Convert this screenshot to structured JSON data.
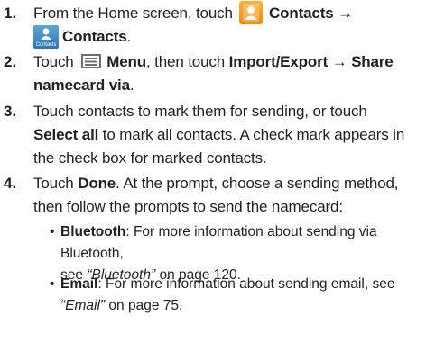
{
  "steps": [
    {
      "number": "1.",
      "text_a": "From the Home screen, touch",
      "icon_a": "contacts-app-icon",
      "bold_a": "Contacts →",
      "icon_b": "contacts-tab-icon",
      "icon_b_label": "Contacts",
      "bold_b": "Contacts",
      "text_end": "."
    },
    {
      "number": "2.",
      "text_a": "Touch",
      "icon_a": "menu-icon",
      "bold_a": "Menu",
      "text_b": ", then touch",
      "bold_b": "Import/Export → Share",
      "bold_c": "namecard via",
      "text_end": "."
    },
    {
      "number": "3.",
      "text_a": "Touch contacts to mark them for sending, or touch",
      "bold_a": "Select all",
      "text_b": "to mark all contacts. A check mark appears in",
      "text_c": "the check box for marked contacts."
    },
    {
      "number": "4.",
      "text_a": "Touch",
      "bold_a": "Done",
      "text_b": ". At the prompt, choose a sending method,",
      "text_c": "then follow the prompts to send the namecard:",
      "bullets": [
        {
          "bullet": "•",
          "term": "Bluetooth",
          "text_a": ": For more information about sending via Bluetooth,",
          "text_b": "see",
          "ref": "“Bluetooth”",
          "text_c": "on page 120."
        },
        {
          "bullet": "•",
          "term": "Email",
          "text_a": ": For more information about sending email, see",
          "ref": "“Email”",
          "text_c": "on page 75."
        }
      ]
    }
  ]
}
